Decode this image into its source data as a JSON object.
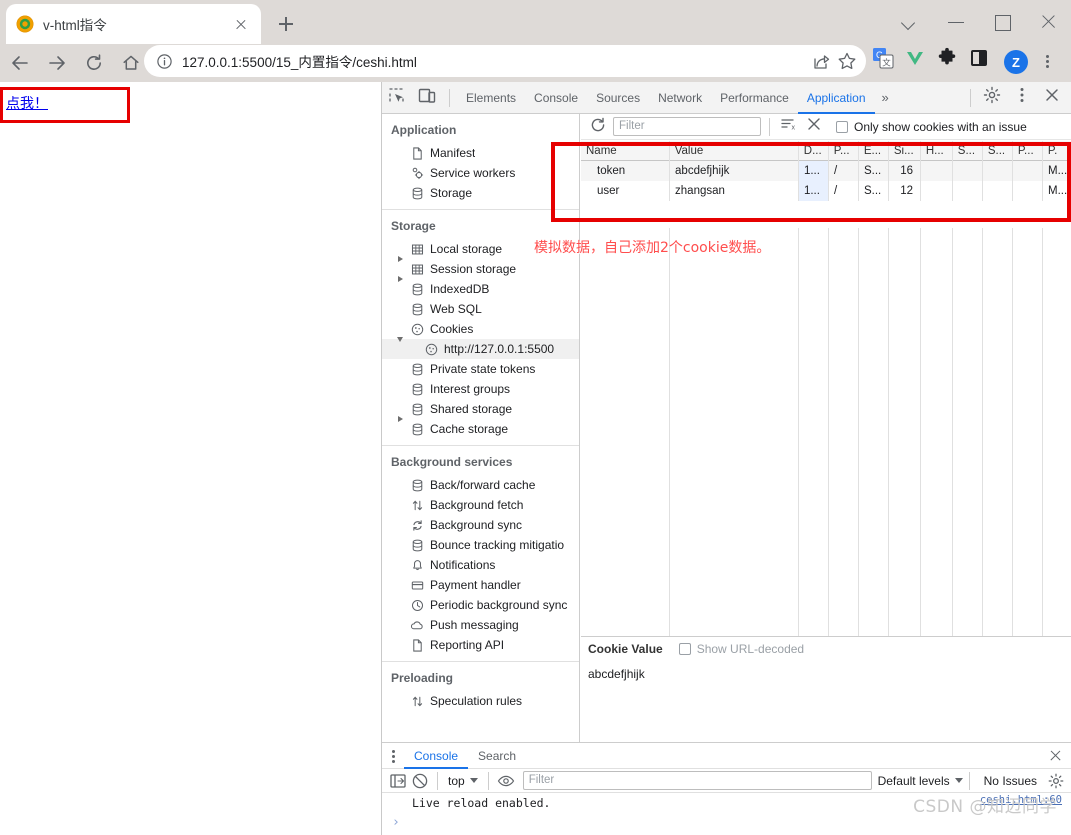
{
  "browser": {
    "tab": {
      "title": "v-html指令",
      "favicon": "vue-logo-icon",
      "close": "close-tab-icon"
    },
    "new_tab": "+",
    "window_controls": [
      "chevron-down-icon",
      "minimize-icon",
      "maximize-icon",
      "close-window-icon"
    ],
    "nav": {
      "back": "back-arrow-icon",
      "forward": "forward-arrow-icon",
      "reload": "reload-icon",
      "home": "home-icon"
    },
    "omnibox": {
      "url": "127.0.0.1:5500/15_内置指令/ceshi.html",
      "info_icon": "site-info-icon",
      "share_icon": "share-icon",
      "bookmark_icon": "star-icon"
    },
    "extensions": [
      "google-translate-icon",
      "vue-devtools-icon",
      "puzzle-extensions-icon",
      "sidepanel-icon"
    ],
    "profile_initial": "Z",
    "menu_icon": "kebab-menu-icon"
  },
  "page": {
    "link_text": "点我！"
  },
  "devtools": {
    "tabs": [
      {
        "label": "Elements",
        "active": false
      },
      {
        "label": "Console",
        "active": false
      },
      {
        "label": "Sources",
        "active": false
      },
      {
        "label": "Network",
        "active": false
      },
      {
        "label": "Performance",
        "active": false
      },
      {
        "label": "Application",
        "active": true
      }
    ],
    "more_tabs": "»",
    "inspect_icon": "inspect-element-icon",
    "device_icon": "device-toolbar-icon",
    "settings_icon": "gear-icon",
    "kebab_icon": "kebab-menu-icon",
    "close_icon": "close-devtools-icon",
    "sidebar": {
      "sections": [
        {
          "title": "Application",
          "items": [
            {
              "label": "Manifest",
              "icon": "document-icon",
              "arrow": "none",
              "selected": false
            },
            {
              "label": "Service workers",
              "icon": "gears-icon",
              "arrow": "none",
              "selected": false
            },
            {
              "label": "Storage",
              "icon": "database-icon",
              "arrow": "none",
              "selected": false
            }
          ]
        },
        {
          "title": "Storage",
          "items": [
            {
              "label": "Local storage",
              "icon": "table-icon",
              "arrow": "collapsed",
              "selected": false
            },
            {
              "label": "Session storage",
              "icon": "table-icon",
              "arrow": "collapsed",
              "selected": false
            },
            {
              "label": "IndexedDB",
              "icon": "database-icon",
              "arrow": "none",
              "selected": false
            },
            {
              "label": "Web SQL",
              "icon": "database-icon",
              "arrow": "none",
              "selected": false
            },
            {
              "label": "Cookies",
              "icon": "cookie-icon",
              "arrow": "expanded",
              "selected": false
            },
            {
              "label": "http://127.0.0.1:5500",
              "icon": "cookie-icon",
              "arrow": "none",
              "selected": true,
              "sub": true
            },
            {
              "label": "Private state tokens",
              "icon": "database-icon",
              "arrow": "none",
              "selected": false
            },
            {
              "label": "Interest groups",
              "icon": "database-icon",
              "arrow": "none",
              "selected": false
            },
            {
              "label": "Shared storage",
              "icon": "database-icon",
              "arrow": "collapsed",
              "selected": false
            },
            {
              "label": "Cache storage",
              "icon": "database-icon",
              "arrow": "none",
              "selected": false
            }
          ]
        },
        {
          "title": "Background services",
          "items": [
            {
              "label": "Back/forward cache",
              "icon": "database-icon",
              "arrow": "none",
              "selected": false
            },
            {
              "label": "Background fetch",
              "icon": "arrows-updown-icon",
              "arrow": "none",
              "selected": false
            },
            {
              "label": "Background sync",
              "icon": "sync-icon",
              "arrow": "none",
              "selected": false
            },
            {
              "label": "Bounce tracking mitigatio",
              "icon": "database-icon",
              "arrow": "none",
              "selected": false
            },
            {
              "label": "Notifications",
              "icon": "bell-icon",
              "arrow": "none",
              "selected": false
            },
            {
              "label": "Payment handler",
              "icon": "credit-card-icon",
              "arrow": "none",
              "selected": false
            },
            {
              "label": "Periodic background sync",
              "icon": "clock-icon",
              "arrow": "none",
              "selected": false
            },
            {
              "label": "Push messaging",
              "icon": "cloud-icon",
              "arrow": "none",
              "selected": false
            },
            {
              "label": "Reporting API",
              "icon": "document-icon",
              "arrow": "none",
              "selected": false
            }
          ]
        },
        {
          "title": "Preloading",
          "items": [
            {
              "label": "Speculation rules",
              "icon": "arrows-updown-icon",
              "arrow": "none",
              "selected": false
            }
          ]
        }
      ]
    },
    "cookies_panel": {
      "refresh_icon": "refresh-icon",
      "filter_placeholder": "Filter",
      "clear_filter_icon": "clear-filter-icon",
      "clear_all_icon": "clear-all-cookies-icon",
      "only_issues_label": "Only show cookies with an issue",
      "only_issues_checked": false,
      "columns": [
        "Name",
        "Value",
        "D...",
        "P...",
        "E...",
        "Si...",
        "H...",
        "S...",
        "S...",
        "P...",
        "P."
      ],
      "rows": [
        {
          "name": "token",
          "value": "abcdefjhijk",
          "domain": "1...",
          "path": "/",
          "expires": "S...",
          "size": "16",
          "httponly": "",
          "secure": "",
          "samesite": "",
          "partition": "",
          "priority": "M..."
        },
        {
          "name": "user",
          "value": "zhangsan",
          "domain": "1...",
          "path": "/",
          "expires": "S...",
          "size": "12",
          "httponly": "",
          "secure": "",
          "samesite": "",
          "partition": "",
          "priority": "M..."
        }
      ],
      "value_pane": {
        "title": "Cookie Value",
        "url_decoded_label": "Show URL-decoded",
        "url_decoded_checked": false,
        "content": "abcdefjhijk"
      }
    },
    "drawer": {
      "kebab_icon": "kebab-menu-icon",
      "tabs": [
        {
          "label": "Console",
          "active": true
        },
        {
          "label": "Search",
          "active": false
        }
      ],
      "close_icon": "close-drawer-icon",
      "sidebar_toggle_icon": "console-sidebar-icon",
      "clear_console_icon": "clear-console-icon",
      "context": "top",
      "eye_icon": "live-expression-icon",
      "filter_placeholder": "Filter",
      "levels": "Default levels",
      "issues": "No Issues",
      "settings_icon": "gear-icon",
      "messages": [
        {
          "text": "Live reload enabled.",
          "source": "ceshi.html:60"
        }
      ],
      "prompt": "›"
    }
  },
  "annotations": {
    "note_text": "模拟数据，自己添加2个cookie数据。",
    "note_color": "#ff4d4d",
    "box_color": "#e60000"
  },
  "watermark": "CSDN @知迈同学"
}
